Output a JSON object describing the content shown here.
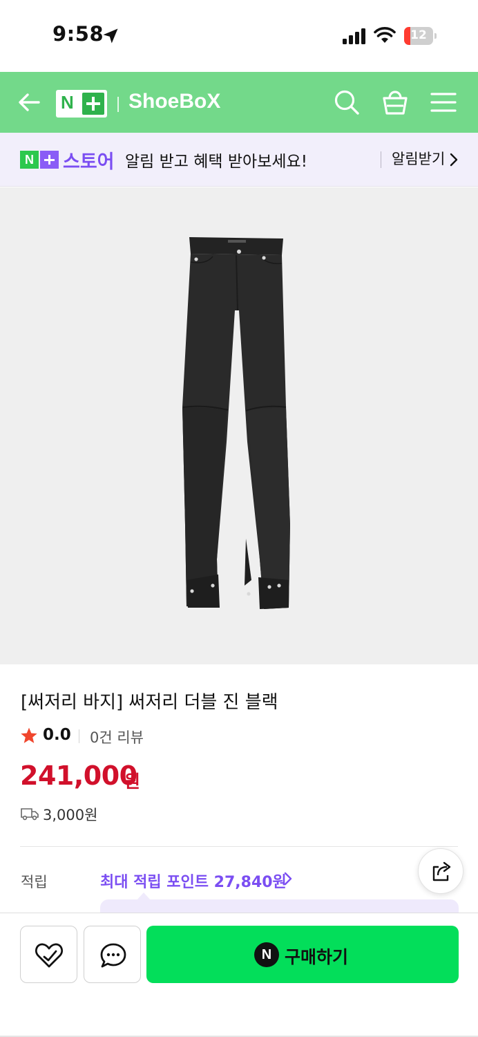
{
  "status_bar": {
    "time": "9:58",
    "battery": "12"
  },
  "header": {
    "logo_text": "N+",
    "store_name": "ShoeBoX"
  },
  "notice": {
    "logo_text": "N+",
    "store_label": "스토어",
    "message": "알림 받고 혜택 받아보세요!",
    "button_label": "알림받기"
  },
  "product": {
    "title": "[써저리 바지] 써저리 더블 진 블랙",
    "rating": "0.0",
    "review_count": "0건 리뷰",
    "price": "241,000",
    "price_unit": "원",
    "shipping_fee": "3,000원"
  },
  "points": {
    "label": "적립",
    "link_text": "최대 적립 포인트 27,840원"
  },
  "bottom_bar": {
    "buy_label": "구매하기",
    "buy_badge": "N"
  },
  "colors": {
    "header_green": "#73d98a",
    "buy_green": "#03de5a",
    "price_red": "#d1102b",
    "purple": "#7b4ef2"
  }
}
